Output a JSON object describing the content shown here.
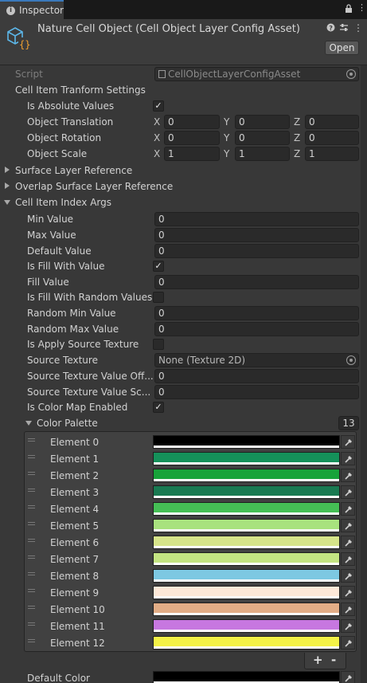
{
  "tab": {
    "label": "Inspector"
  },
  "header": {
    "title": "Nature Cell Object (Cell Object Layer Config Asset)",
    "open_label": "Open"
  },
  "script": {
    "label": "Script",
    "value": "CellObjectLayerConfigAsset"
  },
  "transform": {
    "section_label": "Cell Item Tranform Settings",
    "is_absolute_label": "Is Absolute Values",
    "is_absolute_checked": true,
    "rows": [
      {
        "label": "Object Translation",
        "x": "0",
        "y": "0",
        "z": "0"
      },
      {
        "label": "Object Rotation",
        "x": "0",
        "y": "0",
        "z": "0"
      },
      {
        "label": "Object Scale",
        "x": "1",
        "y": "1",
        "z": "1"
      }
    ],
    "axis": {
      "x": "X",
      "y": "Y",
      "z": "Z"
    }
  },
  "foldouts": {
    "surface": "Surface Layer Reference",
    "overlap": "Overlap Surface Layer Reference",
    "index_args": "Cell Item Index Args"
  },
  "index_args": {
    "min_label": "Min Value",
    "min": "0",
    "max_label": "Max Value",
    "max": "0",
    "default_label": "Default Value",
    "default": "0",
    "fill_with_value_label": "Is Fill With Value",
    "fill_with_value": true,
    "fill_value_label": "Fill Value",
    "fill_value": "0",
    "fill_random_label": "Is Fill With Random Values",
    "fill_random": false,
    "random_min_label": "Random Min Value",
    "random_min": "0",
    "random_max_label": "Random Max Value",
    "random_max": "0",
    "apply_texture_label": "Is Apply Source Texture",
    "apply_texture": false,
    "source_texture_label": "Source Texture",
    "source_texture": "None (Texture 2D)",
    "tex_offset_label": "Source Texture Value Off...",
    "tex_offset": "0",
    "tex_scale_label": "Source Texture Value Sc...",
    "tex_scale": "0",
    "color_map_label": "Is Color Map Enabled",
    "color_map": true
  },
  "palette": {
    "label": "Color Palette",
    "count": "13",
    "elements": [
      {
        "name": "Element 0",
        "color": "#000000",
        "alpha": 1.0
      },
      {
        "name": "Element 1",
        "color": "#15915a",
        "alpha": 1.0
      },
      {
        "name": "Element 2",
        "color": "#17a33a",
        "alpha": 1.0
      },
      {
        "name": "Element 3",
        "color": "#1a7a52",
        "alpha": 1.0
      },
      {
        "name": "Element 4",
        "color": "#45bf55",
        "alpha": 1.0
      },
      {
        "name": "Element 5",
        "color": "#a8e27e",
        "alpha": 1.0
      },
      {
        "name": "Element 6",
        "color": "#d6e48a",
        "alpha": 1.0
      },
      {
        "name": "Element 7",
        "color": "#c3e482",
        "alpha": 1.0
      },
      {
        "name": "Element 8",
        "color": "#7dc8e2",
        "alpha": 1.0
      },
      {
        "name": "Element 9",
        "color": "#fde8d8",
        "alpha": 1.0
      },
      {
        "name": "Element 10",
        "color": "#e2ad86",
        "alpha": 1.0
      },
      {
        "name": "Element 11",
        "color": "#c777e0",
        "alpha": 1.0
      },
      {
        "name": "Element 12",
        "color": "#f4f246",
        "alpha": 1.0
      }
    ],
    "add": "+",
    "remove": "-"
  },
  "default_color": {
    "label": "Default Color",
    "color": "#000000"
  },
  "colors": {
    "accent": "#3a79bb",
    "panel": "#383838",
    "field": "#2a2a2a"
  }
}
